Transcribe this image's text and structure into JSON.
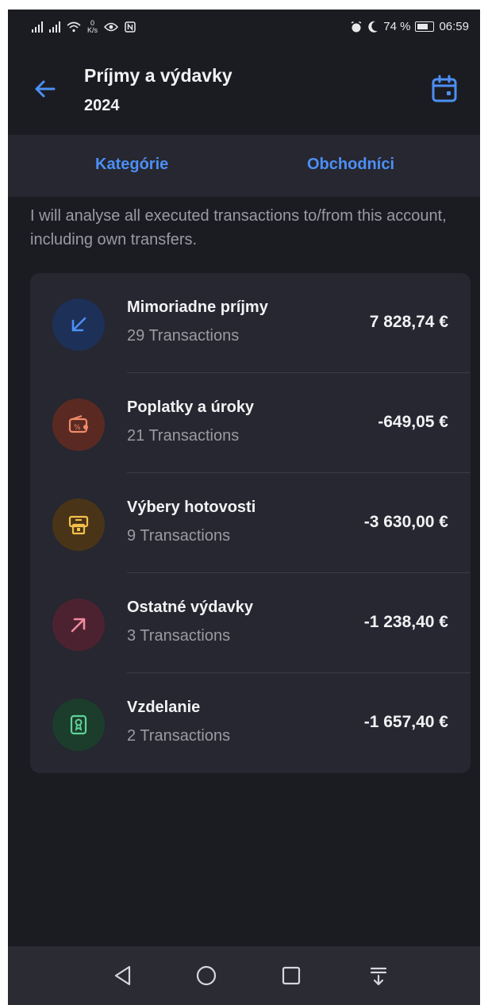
{
  "status_bar": {
    "net_speed_value": "0",
    "net_speed_unit": "K/s",
    "battery": "74 %",
    "time": "06:59"
  },
  "header": {
    "title": "Príjmy a výdavky",
    "year": "2024"
  },
  "tabs": [
    {
      "label": "Kategórie"
    },
    {
      "label": "Obchodníci"
    }
  ],
  "description": "I will analyse all executed transactions to/from this account, including own transfers.",
  "categories": [
    {
      "name": "Mimoriadne príjmy",
      "count": "29 Transactions",
      "amount": "7 828,74 €",
      "icon": "arrow-down-left-icon",
      "color": "#4c8ff5",
      "bg": "#1d3057"
    },
    {
      "name": "Poplatky a úroky",
      "count": "21 Transactions",
      "amount": "-649,05 €",
      "icon": "wallet-percent-icon",
      "color": "#f08a6a",
      "bg": "#5a2a22"
    },
    {
      "name": "Výbery hotovosti",
      "count": "9 Transactions",
      "amount": "-3 630,00 €",
      "icon": "atm-icon",
      "color": "#f5c04a",
      "bg": "#4a3418"
    },
    {
      "name": "Ostatné výdavky",
      "count": "3 Transactions",
      "amount": "-1 238,40 €",
      "icon": "arrow-up-right-icon",
      "color": "#f08aa0",
      "bg": "#4d2230"
    },
    {
      "name": "Vzdelanie",
      "count": "2 Transactions",
      "amount": "-1 657,40 €",
      "icon": "education-badge-icon",
      "color": "#5fd39a",
      "bg": "#1c3d2c"
    }
  ],
  "colors": {
    "accent": "#4c8ff5",
    "background": "#1b1c21",
    "card": "#262730"
  }
}
